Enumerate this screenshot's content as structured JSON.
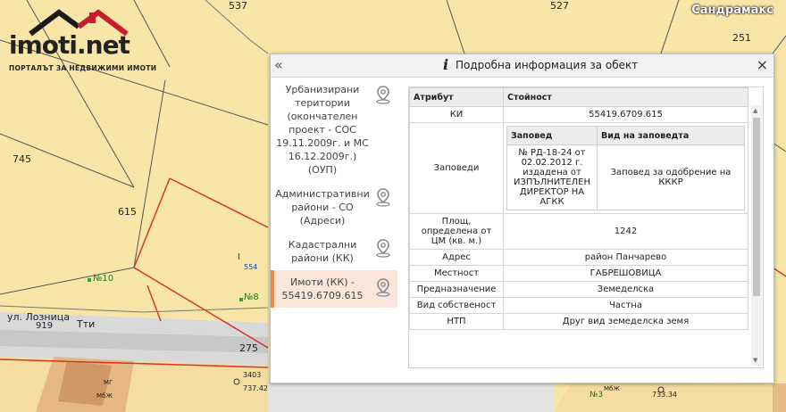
{
  "map": {
    "top_right_label": "Сандрамакс",
    "parcel_labels": [
      "537",
      "527",
      "251",
      "745",
      "615",
      "554",
      "№10",
      "№8",
      "275",
      "3403",
      "737.42",
      "733.34",
      "№3",
      "МбЖ",
      "МбЖ",
      "МГ"
    ],
    "street_label": "ул. Лозница",
    "street_number": "919",
    "street_marker": "Тти",
    "small_marker": "I"
  },
  "logo": {
    "brand": "imoti.net",
    "tagline": "ПОРТАЛЪТ ЗА НЕДВИЖИМИ ИМОТИ"
  },
  "panel": {
    "title": "Подробна информация за обект",
    "info_glyph": "i",
    "collapse_glyph": "«",
    "close_glyph": "×",
    "layers": [
      {
        "label": "Урбанизирани територии (окончателен проект - СОС 19.11.2009г. и МС 16.12.2009г.) (ОУП)",
        "icon": "map-pin-icon"
      },
      {
        "label": "Административни райони - СО (Адреси)",
        "icon": "map-pin-icon"
      },
      {
        "label": "Кадастрални райони (КК)",
        "icon": "map-pin-icon"
      },
      {
        "label": "Имоти (КК) - 55419.6709.615",
        "icon": "map-pin-icon",
        "active": true
      }
    ],
    "table": {
      "col_attribute": "Атрибут",
      "col_value": "Стойност",
      "rows": {
        "ki": {
          "k": "КИ",
          "v": "55419.6709.615"
        },
        "orders": {
          "k": "Заповеди",
          "col_order": "Заповед",
          "col_type": "Вид на заповедта",
          "order": "№ РД-18-24 от 02.02.2012 г. издадена от ИЗПЪЛНИТЕЛЕН ДИРЕКТОР НА АГКК",
          "type": "Заповед за одобрение на КККР"
        },
        "area": {
          "k": "Площ, определена от ЦМ (кв. м.)",
          "v": "1242"
        },
        "address": {
          "k": "Адрес",
          "v": "район Панчарево"
        },
        "locality": {
          "k": "Местност",
          "v": "ГАБРЕШОВИЦА"
        },
        "purpose": {
          "k": "Предназначение",
          "v": "Земеделска"
        },
        "ownership": {
          "k": "Вид собственост",
          "v": "Частна"
        },
        "ntp": {
          "k": "НТП",
          "v": "Друг вид земеделска земя"
        }
      }
    }
  }
}
